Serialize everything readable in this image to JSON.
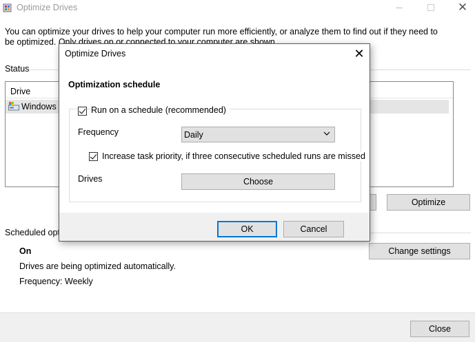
{
  "window": {
    "title": "Optimize Drives",
    "intro": "You can optimize your drives to help your computer run more efficiently, or analyze them to find out if they need to be optimized. Only drives on or connected to your computer are shown.",
    "status_label": "Status",
    "drive_column": "Drive",
    "drives": [
      {
        "name": "Windows (C:)"
      }
    ],
    "optimize_button": "Optimize",
    "scheduled_label": "Scheduled optimization",
    "schedule_status": "On",
    "schedule_desc": "Drives are being optimized automatically.",
    "schedule_frequency": "Frequency: Weekly",
    "change_settings_button": "Change settings",
    "close_button": "Close"
  },
  "dialog": {
    "title": "Optimize Drives",
    "heading": "Optimization schedule",
    "run_on_schedule_label": "Run on a schedule (recommended)",
    "run_on_schedule_checked": true,
    "frequency_label": "Frequency",
    "frequency_value": "Daily",
    "priority_label": "Increase task priority, if three consecutive scheduled runs are missed",
    "priority_checked": true,
    "drives_label": "Drives",
    "choose_button": "Choose",
    "ok_button": "OK",
    "cancel_button": "Cancel"
  },
  "colors": {
    "button_bg": "#e1e1e1",
    "button_border": "#adadad",
    "default_button_border": "#0078d7",
    "selected_row": "#e5e5e5",
    "dialog_bg": "#f0f0f0"
  }
}
